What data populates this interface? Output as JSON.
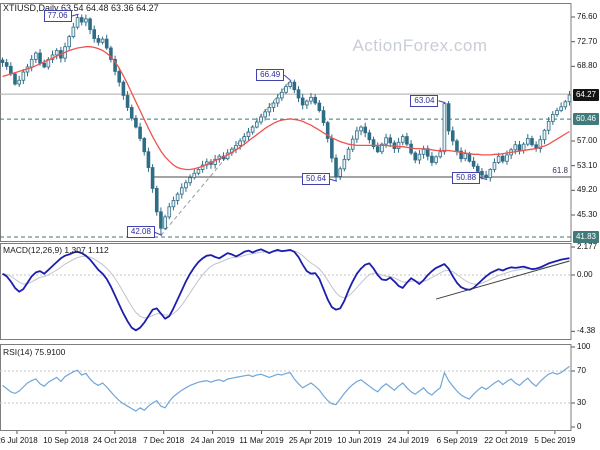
{
  "window_title": "XTIUSD,Daily 63.54 64.48 63.36 64.27",
  "watermark": "ActionForex.com",
  "fib_label": "61.8",
  "indicators": {
    "macd_label": "MACD(12,26,9) 1.307 1.112",
    "rsi_label": "RSI(14) 75.9100"
  },
  "colors": {
    "candle": "#2f6c86",
    "ma_line": "#ef5350",
    "macd_line": "#1c1eae",
    "macd_signal": "#bfc3cb",
    "rsi_line": "#70a6d8",
    "badge_dark": "#141414",
    "badge_teal": "#417a7a",
    "annotation_blue": "#4343ae",
    "frame": "#7d7d7d",
    "watermark": "#c9cdd6",
    "level_gray": "#ababab",
    "level_dark": "#4a4a4a",
    "dashed_teal": "#3d7878",
    "grid_dash": "#c4c4c4",
    "trend_dash": "#9a9a9a",
    "macd_trend": "#3c3c3c"
  },
  "axes": {
    "price_ticks": [
      {
        "label": "76.60",
        "price": 76.6
      },
      {
        "label": "72.70",
        "price": 72.7
      },
      {
        "label": "68.80",
        "price": 68.8
      },
      {
        "label": "57.00",
        "price": 57.0
      },
      {
        "label": "53.10",
        "price": 53.1
      },
      {
        "label": "49.20",
        "price": 49.2
      },
      {
        "label": "45.30",
        "price": 45.3
      }
    ],
    "price_badges": [
      {
        "label": "64.27",
        "price": 64.27,
        "style": "dark",
        "dashed": false
      },
      {
        "label": "60.46",
        "price": 60.46,
        "style": "teal",
        "dashed": true
      },
      {
        "label": "41.83",
        "price": 41.83,
        "style": "teal",
        "dashed": true
      }
    ],
    "macd_ticks": [
      {
        "label": "2.177",
        "value": 2.177
      },
      {
        "label": "0.00",
        "value": 0,
        "dashed": true
      },
      {
        "label": "-4.38",
        "value": -4.38
      }
    ],
    "rsi_ticks": [
      {
        "label": "100",
        "value": 100
      },
      {
        "label": "70",
        "value": 70,
        "dashed": true
      },
      {
        "label": "30",
        "value": 30,
        "dashed": true
      },
      {
        "label": "0",
        "value": 0
      }
    ],
    "dates": [
      "26 Jul 2018",
      "10 Sep 2018",
      "24 Oct 2018",
      "7 Dec 2018",
      "24 Jan 2019",
      "11 Mar 2019",
      "25 Apr 2019",
      "10 Jun 2019",
      "24 Jul 2019",
      "6 Sep 2019",
      "22 Oct 2019",
      "5 Dec 2019"
    ]
  },
  "chart_data": [
    {
      "type": "candlestick",
      "title": "XTIUSD,Daily",
      "ohlc_last": {
        "open": 63.54,
        "high": 64.48,
        "low": 63.36,
        "close": 64.27
      },
      "ylim": [
        41.2,
        78.8
      ],
      "close": [
        69.4,
        68.8,
        67.6,
        66.0,
        66.6,
        67.9,
        68.7,
        69.9,
        70.9,
        69.3,
        68.7,
        69.9,
        70.6,
        71.3,
        70.1,
        71.9,
        73.5,
        75.0,
        76.5,
        75.8,
        76.3,
        74.6,
        73.2,
        72.6,
        73.1,
        71.7,
        69.9,
        68.0,
        66.3,
        64.2,
        62.3,
        60.6,
        59.2,
        57.4,
        55.3,
        52.8,
        49.5,
        45.8,
        43.2,
        45.0,
        46.6,
        47.6,
        48.6,
        49.6,
        50.4,
        51.2,
        51.9,
        52.5,
        53.2,
        53.7,
        53.3,
        54.1,
        54.6,
        54.2,
        55.1,
        55.7,
        56.3,
        57.0,
        57.7,
        58.4,
        59.2,
        60.0,
        60.8,
        61.6,
        62.3,
        63.0,
        63.8,
        64.7,
        65.6,
        66.3,
        65.1,
        63.8,
        62.7,
        63.3,
        63.9,
        63.0,
        61.8,
        59.9,
        57.4,
        54.3,
        51.4,
        52.6,
        54.1,
        55.7,
        57.3,
        58.6,
        59.2,
        58.3,
        57.2,
        56.1,
        55.3,
        56.5,
        57.5,
        56.7,
        55.8,
        56.8,
        57.7,
        56.5,
        55.1,
        54.0,
        54.9,
        55.8,
        54.6,
        53.6,
        54.5,
        55.3,
        62.9,
        58.6,
        57.0,
        55.4,
        54.2,
        55.0,
        53.8,
        53.0,
        52.2,
        51.6,
        51.2,
        52.5,
        53.6,
        54.6,
        53.8,
        54.8,
        55.6,
        56.4,
        55.5,
        56.5,
        57.4,
        56.4,
        55.8,
        57.2,
        58.7,
        60.1,
        61.2,
        61.8,
        62.4,
        63.2,
        64.27
      ],
      "ma_red": [
        67.2,
        67.4,
        67.6,
        67.8,
        68.0,
        68.2,
        68.4,
        68.6,
        68.9,
        69.2,
        69.5,
        69.8,
        70.1,
        70.4,
        70.7,
        71.0,
        71.3,
        71.5,
        71.7,
        71.8,
        71.9,
        71.9,
        71.8,
        71.6,
        71.3,
        70.9,
        70.3,
        69.5,
        68.5,
        67.3,
        66.0,
        64.6,
        63.2,
        61.8,
        60.4,
        59.0,
        57.7,
        56.5,
        55.4,
        54.5,
        53.8,
        53.2,
        52.8,
        52.6,
        52.5,
        52.5,
        52.6,
        52.8,
        53.0,
        53.3,
        53.6,
        53.9,
        54.2,
        54.5,
        54.8,
        55.2,
        55.6,
        56.0,
        56.5,
        57.0,
        57.5,
        58.0,
        58.5,
        59.0,
        59.4,
        59.8,
        60.1,
        60.3,
        60.4,
        60.5,
        60.4,
        60.3,
        60.1,
        59.8,
        59.5,
        59.1,
        58.7,
        58.3,
        57.9,
        57.5,
        57.2,
        56.9,
        56.7,
        56.5,
        56.4,
        56.3,
        56.3,
        56.3,
        56.3,
        56.3,
        56.3,
        56.3,
        56.3,
        56.2,
        56.2,
        56.1,
        56.1,
        56.0,
        55.9,
        55.8,
        55.8,
        55.7,
        55.7,
        55.6,
        55.5,
        55.5,
        55.5,
        55.5,
        55.4,
        55.3,
        55.2,
        55.1,
        55.0,
        54.9,
        54.9,
        54.8,
        54.8,
        54.8,
        54.9,
        54.9,
        55.0,
        55.1,
        55.2,
        55.3,
        55.4,
        55.5,
        55.6,
        55.7,
        55.8,
        56.0,
        56.2,
        56.5,
        56.9,
        57.3,
        57.7,
        58.1,
        58.5
      ],
      "key_points": [
        {
          "index": 18,
          "kind": "high",
          "price": 77.06,
          "label": "77.06",
          "dy": 2
        },
        {
          "index": 69,
          "kind": "high",
          "price": 66.49,
          "label": "66.49",
          "dy": -6
        },
        {
          "index": 106,
          "kind": "high",
          "price": 63.04,
          "label": "63.04",
          "dy": -2
        },
        {
          "index": 80,
          "kind": "low",
          "price": 50.64,
          "label": "50.64",
          "dy": -2
        },
        {
          "index": 116,
          "kind": "low",
          "price": 50.88,
          "label": "50.88",
          "dy": -2
        },
        {
          "index": 38,
          "kind": "low",
          "price": 42.08,
          "label": "42.08",
          "dy": -3
        }
      ],
      "levels": [
        {
          "price": 64.4,
          "style": "solid-gray",
          "from_index": 0
        },
        {
          "price": 51.3,
          "style": "solid-dark",
          "from_index": 36
        }
      ],
      "trendlines": [
        {
          "i1": 38,
          "p1": 42.08,
          "i2": 69,
          "p2": 66.49,
          "style": "dashed"
        }
      ]
    },
    {
      "type": "line",
      "name": "MACD(12,26,9)",
      "last_values": [
        1.307,
        1.112
      ],
      "ylim": [
        -4.98,
        2.49
      ],
      "values": [
        0.1,
        -0.1,
        -0.5,
        -1.0,
        -1.3,
        -1.1,
        -0.6,
        -0.1,
        0.2,
        0.3,
        0.1,
        0.4,
        0.7,
        1.0,
        1.3,
        1.5,
        1.6,
        1.75,
        1.8,
        1.7,
        1.5,
        1.2,
        0.8,
        0.4,
        0.1,
        -0.3,
        -0.9,
        -1.6,
        -2.3,
        -3.0,
        -3.6,
        -4.1,
        -4.3,
        -4.1,
        -3.7,
        -3.2,
        -2.7,
        -2.6,
        -3.0,
        -3.4,
        -3.2,
        -2.6,
        -1.9,
        -1.2,
        -0.5,
        0.1,
        0.6,
        1.0,
        1.3,
        1.5,
        1.55,
        1.4,
        1.3,
        1.5,
        1.7,
        1.6,
        1.45,
        1.6,
        1.8,
        1.9,
        1.75,
        1.9,
        2.0,
        1.85,
        1.7,
        1.85,
        1.95,
        1.85,
        1.9,
        1.95,
        1.8,
        1.4,
        0.8,
        0.3,
        0.1,
        0.15,
        -0.3,
        -1.1,
        -1.9,
        -2.5,
        -2.7,
        -2.6,
        -2.0,
        -1.2,
        -0.5,
        0.1,
        0.5,
        0.8,
        0.9,
        0.5,
        0.0,
        -0.35,
        -0.4,
        -0.2,
        -0.5,
        -0.85,
        -1.0,
        -0.6,
        -0.25,
        -0.45,
        -0.7,
        -0.4,
        0.0,
        0.3,
        0.55,
        0.7,
        0.85,
        0.5,
        -0.1,
        -0.6,
        -0.95,
        -1.1,
        -1.15,
        -1.0,
        -0.7,
        -0.4,
        -0.1,
        0.15,
        0.3,
        0.45,
        0.35,
        0.5,
        0.6,
        0.55,
        0.6,
        0.65,
        0.55,
        0.45,
        0.5,
        0.6,
        0.75,
        0.9,
        1.0,
        1.1,
        1.2,
        1.25,
        1.31
      ],
      "trendline": {
        "i1": 104,
        "v1": -1.87,
        "i2": 136,
        "v2": 1.09
      }
    },
    {
      "type": "line",
      "name": "RSI(14)",
      "last_value": 75.91,
      "ylim": [
        0,
        100
      ],
      "overbought": 70,
      "oversold": 30,
      "values": [
        52,
        48,
        44,
        42,
        45,
        50,
        55,
        58,
        60,
        54,
        51,
        56,
        59,
        62,
        57,
        63,
        66,
        69,
        71,
        65,
        67,
        60,
        55,
        52,
        55,
        50,
        44,
        38,
        33,
        29,
        26,
        23,
        20,
        24,
        21,
        26,
        30,
        33,
        26,
        24,
        32,
        38,
        42,
        46,
        49,
        52,
        54,
        56,
        57,
        58,
        56,
        58,
        59,
        57,
        60,
        61,
        62,
        63,
        64,
        65,
        63,
        65,
        66,
        64,
        62,
        64,
        66,
        65,
        67,
        68,
        60,
        54,
        49,
        52,
        55,
        51,
        46,
        39,
        33,
        29,
        28,
        35,
        42,
        48,
        53,
        57,
        59,
        55,
        51,
        47,
        44,
        50,
        54,
        50,
        46,
        51,
        55,
        49,
        44,
        41,
        45,
        49,
        43,
        40,
        45,
        49,
        68,
        58,
        51,
        45,
        40,
        37,
        35,
        41,
        46,
        50,
        47,
        51,
        55,
        58,
        53,
        57,
        60,
        55,
        52,
        57,
        61,
        55,
        51,
        57,
        62,
        66,
        68,
        66,
        68,
        72,
        75.9
      ]
    }
  ]
}
